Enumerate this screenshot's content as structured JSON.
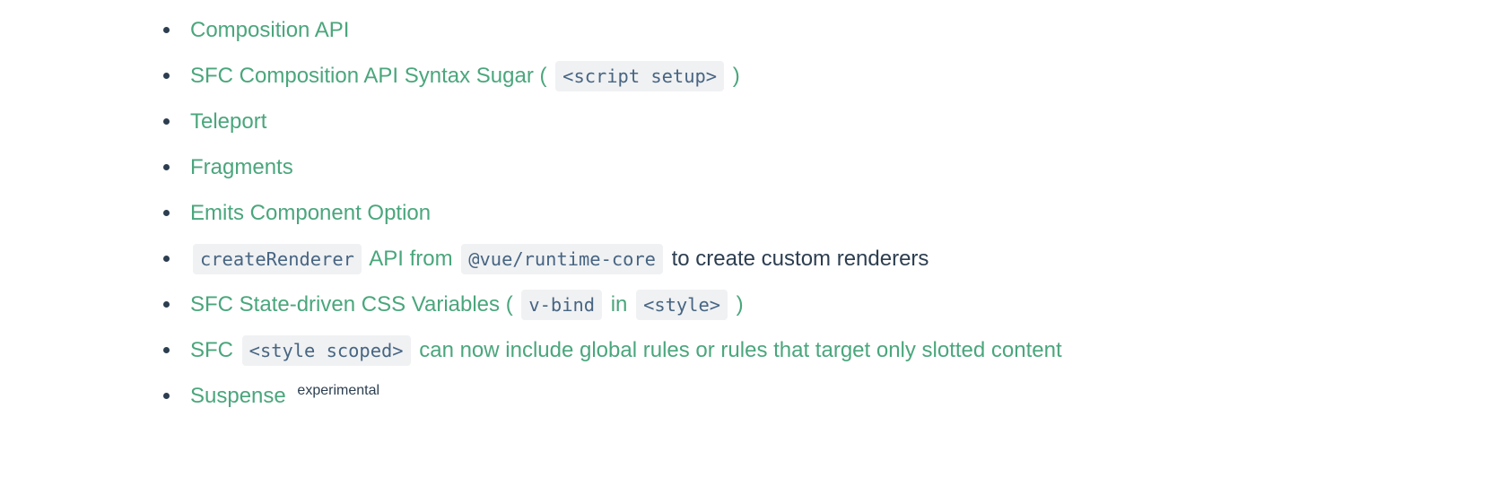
{
  "document": {
    "type": "bullet-list",
    "background_color": "#ffffff",
    "link_color": "#4aa67c",
    "text_color": "#2c3e50",
    "code_bg_color": "#f0f1f3",
    "code_text_color": "#476582",
    "bullet_color": "#2c3e50"
  },
  "list": {
    "items": [
      {
        "id": "composition-api",
        "segments": [
          {
            "kind": "link",
            "text": "Composition API"
          }
        ]
      },
      {
        "id": "sfc-composition-api-syntax-sugar",
        "segments": [
          {
            "kind": "link",
            "text": "SFC Composition API Syntax Sugar ("
          },
          {
            "kind": "code",
            "text": "<script setup>"
          },
          {
            "kind": "link",
            "text": ")"
          }
        ]
      },
      {
        "id": "teleport",
        "segments": [
          {
            "kind": "link",
            "text": "Teleport"
          }
        ]
      },
      {
        "id": "fragments",
        "segments": [
          {
            "kind": "link",
            "text": "Fragments"
          }
        ]
      },
      {
        "id": "emits-component-option",
        "segments": [
          {
            "kind": "link",
            "text": "Emits Component Option"
          }
        ]
      },
      {
        "id": "create-renderer",
        "segments": [
          {
            "kind": "code",
            "text": "createRenderer"
          },
          {
            "kind": "link",
            "text": "API from"
          },
          {
            "kind": "code",
            "text": "@vue/runtime-core"
          },
          {
            "kind": "plain",
            "text": "to create custom renderers"
          }
        ]
      },
      {
        "id": "sfc-state-driven-css-variables",
        "segments": [
          {
            "kind": "link",
            "text": "SFC State-driven CSS Variables ("
          },
          {
            "kind": "code",
            "text": "v-bind"
          },
          {
            "kind": "link",
            "text": "in"
          },
          {
            "kind": "code",
            "text": "<style>"
          },
          {
            "kind": "link",
            "text": ")"
          }
        ]
      },
      {
        "id": "sfc-style-scoped",
        "segments": [
          {
            "kind": "link",
            "text": "SFC"
          },
          {
            "kind": "code",
            "text": "<style scoped>"
          },
          {
            "kind": "link",
            "text": "can now include global rules or rules that target only slotted content"
          }
        ]
      },
      {
        "id": "suspense",
        "segments": [
          {
            "kind": "link",
            "text": "Suspense"
          },
          {
            "kind": "sup",
            "text": "experimental"
          }
        ]
      }
    ]
  }
}
